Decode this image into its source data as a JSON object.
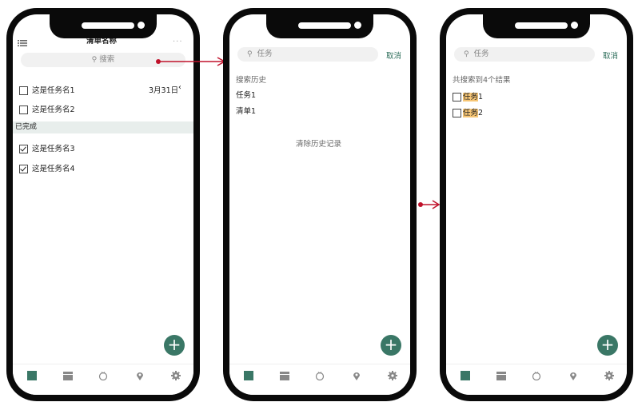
{
  "colors": {
    "accent": "#3a7766",
    "arrow": "#c0122b",
    "highlight": "#f7c675",
    "section_bg": "#e8eeec"
  },
  "screen1": {
    "title": "清单名称",
    "menu_icon": "list-icon",
    "more_icon": "more-icon",
    "search_placeholder": "搜索",
    "tasks": [
      {
        "name": "这是任务名1",
        "due": "3月31日"
      },
      {
        "name": "这是任务名2"
      }
    ],
    "completed_header": "已完成",
    "completed": [
      {
        "name": "这是任务名3"
      },
      {
        "name": "这是任务名4"
      }
    ]
  },
  "screen2": {
    "search_value": "任务",
    "cancel": "取消",
    "history_header": "搜索历史",
    "history": [
      "任务1",
      "清单1"
    ],
    "clear_history": "清除历史记录"
  },
  "screen3": {
    "search_value": "任务",
    "cancel": "取消",
    "results_summary": "共搜索到4个结果",
    "results": [
      {
        "match": "任务",
        "rest": "1"
      },
      {
        "match": "任务",
        "rest": "2"
      }
    ]
  },
  "fab_label": "+",
  "tabbar": [
    "list-icon",
    "calendar-icon",
    "timer-icon",
    "location-icon",
    "settings-icon"
  ]
}
